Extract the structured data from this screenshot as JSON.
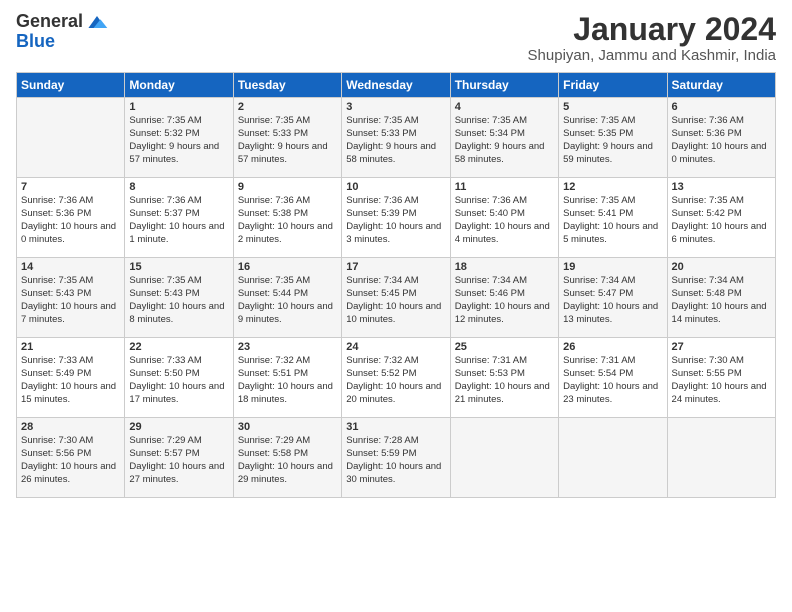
{
  "header": {
    "logo_general": "General",
    "logo_blue": "Blue",
    "month": "January 2024",
    "location": "Shupiyan, Jammu and Kashmir, India"
  },
  "days_of_week": [
    "Sunday",
    "Monday",
    "Tuesday",
    "Wednesday",
    "Thursday",
    "Friday",
    "Saturday"
  ],
  "weeks": [
    [
      {
        "day": "",
        "sunrise": "",
        "sunset": "",
        "daylight": ""
      },
      {
        "day": "1",
        "sunrise": "Sunrise: 7:35 AM",
        "sunset": "Sunset: 5:32 PM",
        "daylight": "Daylight: 9 hours and 57 minutes."
      },
      {
        "day": "2",
        "sunrise": "Sunrise: 7:35 AM",
        "sunset": "Sunset: 5:33 PM",
        "daylight": "Daylight: 9 hours and 57 minutes."
      },
      {
        "day": "3",
        "sunrise": "Sunrise: 7:35 AM",
        "sunset": "Sunset: 5:33 PM",
        "daylight": "Daylight: 9 hours and 58 minutes."
      },
      {
        "day": "4",
        "sunrise": "Sunrise: 7:35 AM",
        "sunset": "Sunset: 5:34 PM",
        "daylight": "Daylight: 9 hours and 58 minutes."
      },
      {
        "day": "5",
        "sunrise": "Sunrise: 7:35 AM",
        "sunset": "Sunset: 5:35 PM",
        "daylight": "Daylight: 9 hours and 59 minutes."
      },
      {
        "day": "6",
        "sunrise": "Sunrise: 7:36 AM",
        "sunset": "Sunset: 5:36 PM",
        "daylight": "Daylight: 10 hours and 0 minutes."
      }
    ],
    [
      {
        "day": "7",
        "sunrise": "Sunrise: 7:36 AM",
        "sunset": "Sunset: 5:36 PM",
        "daylight": "Daylight: 10 hours and 0 minutes."
      },
      {
        "day": "8",
        "sunrise": "Sunrise: 7:36 AM",
        "sunset": "Sunset: 5:37 PM",
        "daylight": "Daylight: 10 hours and 1 minute."
      },
      {
        "day": "9",
        "sunrise": "Sunrise: 7:36 AM",
        "sunset": "Sunset: 5:38 PM",
        "daylight": "Daylight: 10 hours and 2 minutes."
      },
      {
        "day": "10",
        "sunrise": "Sunrise: 7:36 AM",
        "sunset": "Sunset: 5:39 PM",
        "daylight": "Daylight: 10 hours and 3 minutes."
      },
      {
        "day": "11",
        "sunrise": "Sunrise: 7:36 AM",
        "sunset": "Sunset: 5:40 PM",
        "daylight": "Daylight: 10 hours and 4 minutes."
      },
      {
        "day": "12",
        "sunrise": "Sunrise: 7:35 AM",
        "sunset": "Sunset: 5:41 PM",
        "daylight": "Daylight: 10 hours and 5 minutes."
      },
      {
        "day": "13",
        "sunrise": "Sunrise: 7:35 AM",
        "sunset": "Sunset: 5:42 PM",
        "daylight": "Daylight: 10 hours and 6 minutes."
      }
    ],
    [
      {
        "day": "14",
        "sunrise": "Sunrise: 7:35 AM",
        "sunset": "Sunset: 5:43 PM",
        "daylight": "Daylight: 10 hours and 7 minutes."
      },
      {
        "day": "15",
        "sunrise": "Sunrise: 7:35 AM",
        "sunset": "Sunset: 5:43 PM",
        "daylight": "Daylight: 10 hours and 8 minutes."
      },
      {
        "day": "16",
        "sunrise": "Sunrise: 7:35 AM",
        "sunset": "Sunset: 5:44 PM",
        "daylight": "Daylight: 10 hours and 9 minutes."
      },
      {
        "day": "17",
        "sunrise": "Sunrise: 7:34 AM",
        "sunset": "Sunset: 5:45 PM",
        "daylight": "Daylight: 10 hours and 10 minutes."
      },
      {
        "day": "18",
        "sunrise": "Sunrise: 7:34 AM",
        "sunset": "Sunset: 5:46 PM",
        "daylight": "Daylight: 10 hours and 12 minutes."
      },
      {
        "day": "19",
        "sunrise": "Sunrise: 7:34 AM",
        "sunset": "Sunset: 5:47 PM",
        "daylight": "Daylight: 10 hours and 13 minutes."
      },
      {
        "day": "20",
        "sunrise": "Sunrise: 7:34 AM",
        "sunset": "Sunset: 5:48 PM",
        "daylight": "Daylight: 10 hours and 14 minutes."
      }
    ],
    [
      {
        "day": "21",
        "sunrise": "Sunrise: 7:33 AM",
        "sunset": "Sunset: 5:49 PM",
        "daylight": "Daylight: 10 hours and 15 minutes."
      },
      {
        "day": "22",
        "sunrise": "Sunrise: 7:33 AM",
        "sunset": "Sunset: 5:50 PM",
        "daylight": "Daylight: 10 hours and 17 minutes."
      },
      {
        "day": "23",
        "sunrise": "Sunrise: 7:32 AM",
        "sunset": "Sunset: 5:51 PM",
        "daylight": "Daylight: 10 hours and 18 minutes."
      },
      {
        "day": "24",
        "sunrise": "Sunrise: 7:32 AM",
        "sunset": "Sunset: 5:52 PM",
        "daylight": "Daylight: 10 hours and 20 minutes."
      },
      {
        "day": "25",
        "sunrise": "Sunrise: 7:31 AM",
        "sunset": "Sunset: 5:53 PM",
        "daylight": "Daylight: 10 hours and 21 minutes."
      },
      {
        "day": "26",
        "sunrise": "Sunrise: 7:31 AM",
        "sunset": "Sunset: 5:54 PM",
        "daylight": "Daylight: 10 hours and 23 minutes."
      },
      {
        "day": "27",
        "sunrise": "Sunrise: 7:30 AM",
        "sunset": "Sunset: 5:55 PM",
        "daylight": "Daylight: 10 hours and 24 minutes."
      }
    ],
    [
      {
        "day": "28",
        "sunrise": "Sunrise: 7:30 AM",
        "sunset": "Sunset: 5:56 PM",
        "daylight": "Daylight: 10 hours and 26 minutes."
      },
      {
        "day": "29",
        "sunrise": "Sunrise: 7:29 AM",
        "sunset": "Sunset: 5:57 PM",
        "daylight": "Daylight: 10 hours and 27 minutes."
      },
      {
        "day": "30",
        "sunrise": "Sunrise: 7:29 AM",
        "sunset": "Sunset: 5:58 PM",
        "daylight": "Daylight: 10 hours and 29 minutes."
      },
      {
        "day": "31",
        "sunrise": "Sunrise: 7:28 AM",
        "sunset": "Sunset: 5:59 PM",
        "daylight": "Daylight: 10 hours and 30 minutes."
      },
      {
        "day": "",
        "sunrise": "",
        "sunset": "",
        "daylight": ""
      },
      {
        "day": "",
        "sunrise": "",
        "sunset": "",
        "daylight": ""
      },
      {
        "day": "",
        "sunrise": "",
        "sunset": "",
        "daylight": ""
      }
    ]
  ]
}
